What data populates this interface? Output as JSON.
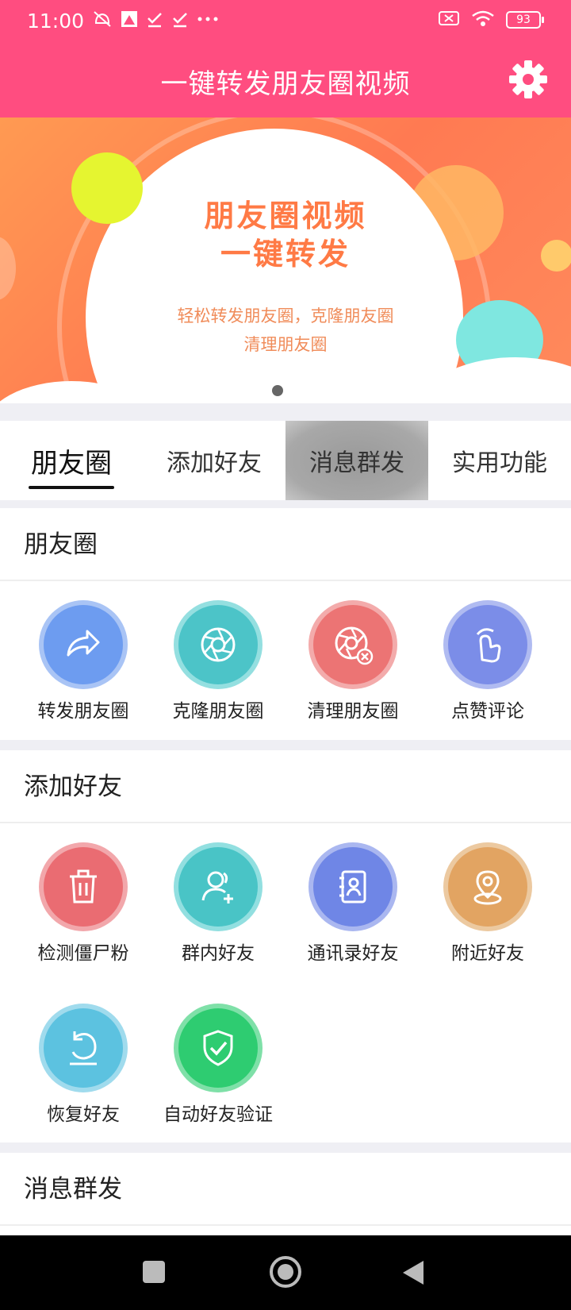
{
  "status_bar": {
    "time": "11:00",
    "battery": "93",
    "icons": [
      "mute-icon",
      "app-icon",
      "check-icon",
      "check-icon",
      "more-icon",
      "sim-icon",
      "wifi-icon",
      "battery-icon"
    ]
  },
  "app_bar": {
    "title": "一键转发朋友圈视频",
    "settings_icon": "gear-icon"
  },
  "banner": {
    "headline_line1": "朋友圈视频",
    "headline_line2": "一键转发",
    "subtitle_line1": "轻松转发朋友圈，克隆朋友圈",
    "subtitle_line2": "清理朋友圈",
    "page_count": 1,
    "current_page": 1
  },
  "tabs": [
    {
      "label": "朋友圈",
      "active": true
    },
    {
      "label": "添加好友",
      "active": false
    },
    {
      "label": "消息群发",
      "active": false
    },
    {
      "label": "实用功能",
      "active": false
    }
  ],
  "sections": {
    "moments": {
      "title": "朋友圈",
      "items": [
        {
          "label": "转发朋友圈",
          "icon": "share-arrow-icon",
          "color": "#6d9cf0"
        },
        {
          "label": "克隆朋友圈",
          "icon": "camera-shutter-icon",
          "color": "#4cc4c8"
        },
        {
          "label": "清理朋友圈",
          "icon": "camera-shutter-delete-icon",
          "color": "#ec7474"
        },
        {
          "label": "点赞评论",
          "icon": "tap-hand-icon",
          "color": "#7b8de8"
        }
      ]
    },
    "add_friends": {
      "title": "添加好友",
      "items": [
        {
          "label": "检测僵尸粉",
          "icon": "trash-icon",
          "color": "#ea6c72"
        },
        {
          "label": "群内好友",
          "icon": "add-user-icon",
          "color": "#49c4c6"
        },
        {
          "label": "通讯录好友",
          "icon": "contacts-book-icon",
          "color": "#6f86e6"
        },
        {
          "label": "附近好友",
          "icon": "location-pin-icon",
          "color": "#e2a462"
        },
        {
          "label": "恢复好友",
          "icon": "restore-icon",
          "color": "#5cc2e0"
        },
        {
          "label": "自动好友验证",
          "icon": "shield-check-icon",
          "color": "#2ecc71"
        }
      ]
    },
    "mass_message": {
      "title": "消息群发"
    }
  },
  "nav_bar": {
    "icons": [
      "recents-square-icon",
      "home-circle-icon",
      "back-triangle-icon"
    ]
  }
}
